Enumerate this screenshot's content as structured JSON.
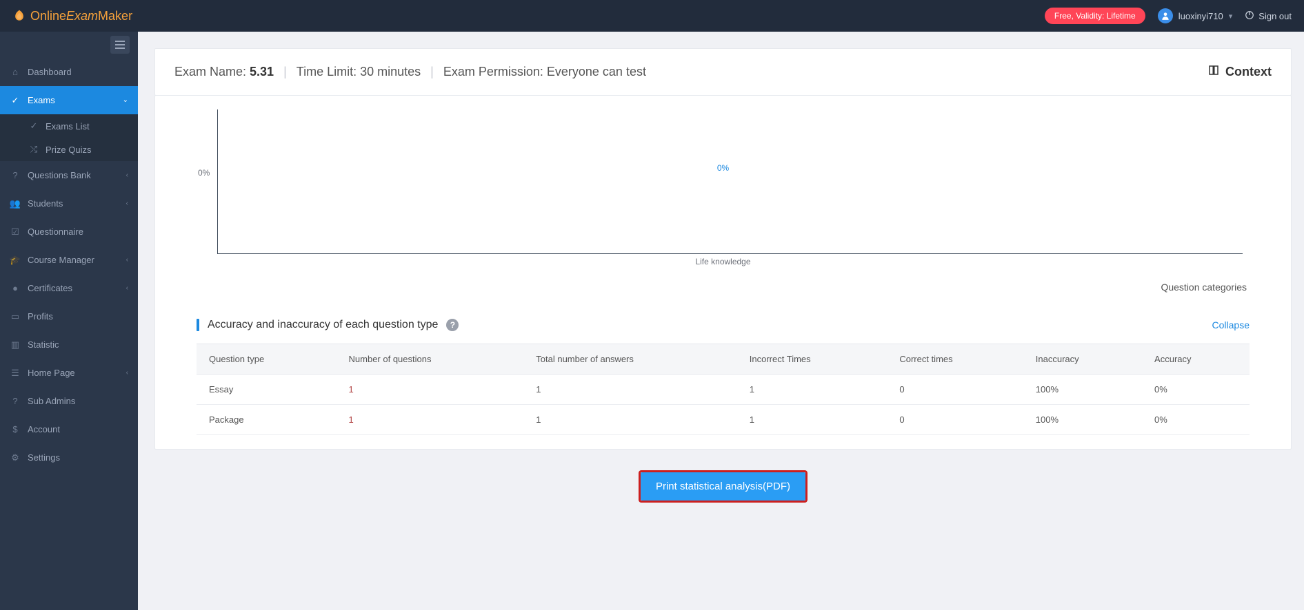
{
  "brand": {
    "text_a": "Online",
    "text_b": "Exam",
    "text_c": "Maker"
  },
  "topbar": {
    "pill": "Free, Validity: Lifetime",
    "username": "luoxinyi710",
    "signout": "Sign out"
  },
  "sidebar": {
    "items": [
      {
        "label": "Dashboard"
      },
      {
        "label": "Exams"
      },
      {
        "label": "Questions Bank"
      },
      {
        "label": "Students"
      },
      {
        "label": "Questionnaire"
      },
      {
        "label": "Course Manager"
      },
      {
        "label": "Certificates"
      },
      {
        "label": "Profits"
      },
      {
        "label": "Statistic"
      },
      {
        "label": "Home Page"
      },
      {
        "label": "Sub Admins"
      },
      {
        "label": "Account"
      },
      {
        "label": "Settings"
      }
    ],
    "sub_exams": [
      {
        "label": "Exams List"
      },
      {
        "label": "Prize Quizs"
      }
    ]
  },
  "header": {
    "exam_name_label": "Exam Name: ",
    "exam_name_value": "5.31",
    "time_limit": "Time Limit: 30 minutes",
    "permission": "Exam Permission: Everyone can test",
    "context": "Context"
  },
  "chart_data": {
    "type": "bar",
    "categories": [
      "Life knowledge"
    ],
    "values": [
      0
    ],
    "data_labels": [
      "0%"
    ],
    "ylabel_tick": "0%",
    "xlabel": "Question categories",
    "ylim": [
      0,
      100
    ]
  },
  "section": {
    "title": "Accuracy and inaccuracy of each question type",
    "collapse": "Collapse"
  },
  "table": {
    "headers": [
      "Question type",
      "Number of questions",
      "Total number of answers",
      "Incorrect Times",
      "Correct times",
      "Inaccuracy",
      "Accuracy"
    ],
    "rows": [
      {
        "type": "Essay",
        "num_q": "1",
        "answers": "1",
        "incorrect": "1",
        "correct": "0",
        "inaccuracy": "100%",
        "accuracy": "0%"
      },
      {
        "type": "Package",
        "num_q": "1",
        "answers": "1",
        "incorrect": "1",
        "correct": "0",
        "inaccuracy": "100%",
        "accuracy": "0%"
      }
    ]
  },
  "print_button": "Print statistical analysis(PDF)"
}
